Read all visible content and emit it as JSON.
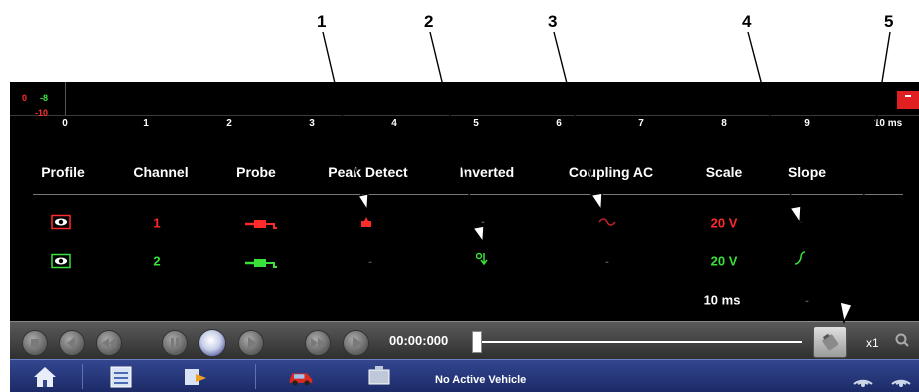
{
  "callouts": [
    "1",
    "2",
    "3",
    "4",
    "5"
  ],
  "scope_strip": {
    "levels": [
      {
        "a": "0",
        "b": "-8",
        "color_a": "#ff3030",
        "color_b": "#39e13a"
      },
      {
        "a": "-10",
        "color_a": "#ff3030"
      }
    ],
    "ticks": [
      "0",
      "1",
      "2",
      "3",
      "4",
      "5",
      "6",
      "7",
      "8",
      "9",
      "10 ms"
    ]
  },
  "table": {
    "headers": [
      "Profile",
      "Channel",
      "Probe",
      "Peak Detect",
      "Inverted",
      "Coupling AC",
      "Scale",
      "Slope"
    ],
    "rows": [
      {
        "channel": "1",
        "scale": "20 V",
        "color": "#ff2a2a"
      },
      {
        "channel": "2",
        "scale": "20 V",
        "color": "#39e13a"
      }
    ],
    "timebase": "10 ms"
  },
  "controls": {
    "time": "00:00:000",
    "zoom": "x1"
  },
  "taskbar": {
    "vehicle_status": "No Active Vehicle"
  },
  "colors": {
    "channel1": "#ff2a2a",
    "channel2": "#39e13a",
    "taskbar": "#24367a"
  },
  "icons": [
    "home-icon",
    "list-icon",
    "data-icon",
    "vehicle-icon",
    "scope-icon",
    "wireless-icon",
    "clipboard-icon",
    "zoom-icon"
  ]
}
